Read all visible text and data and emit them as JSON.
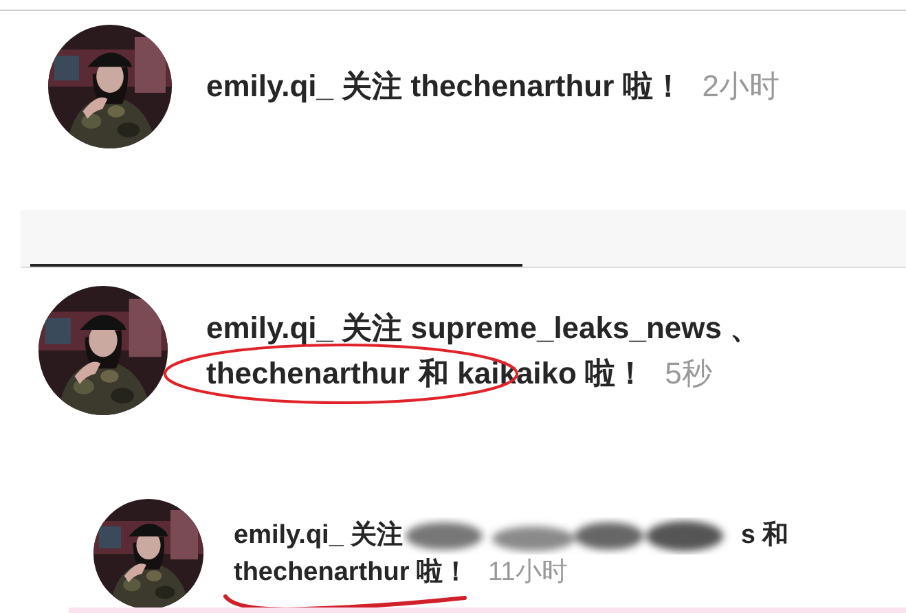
{
  "notifications": [
    {
      "lines": [
        [
          {
            "kind": "text",
            "text": "emily.qi_ 关注 thechenarthur 啦！"
          }
        ]
      ],
      "time": "2小时"
    },
    {
      "tab_bar": {
        "tabs": [
          {
            "selected": true
          }
        ]
      }
    },
    {
      "lines": [
        [
          {
            "kind": "text",
            "text": "emily.qi_ 关注 supreme_leaks_news 、"
          }
        ],
        [
          {
            "kind": "text",
            "text": "thechenarthur"
          },
          {
            "kind": "text",
            "text": "和 kaikaiko 啦！"
          }
        ]
      ],
      "time": "5秒",
      "annotation": {
        "kind": "ellipse"
      }
    },
    {
      "lines": [
        [
          {
            "kind": "text",
            "text": "emily.qi_ 关注"
          },
          {
            "kind": "redaction"
          },
          {
            "kind": "text",
            "text": "s 和"
          }
        ],
        [
          {
            "kind": "text",
            "text": "thechenarthur 啦！"
          }
        ]
      ],
      "time": "11小时",
      "annotation": {
        "kind": "underline"
      }
    }
  ]
}
